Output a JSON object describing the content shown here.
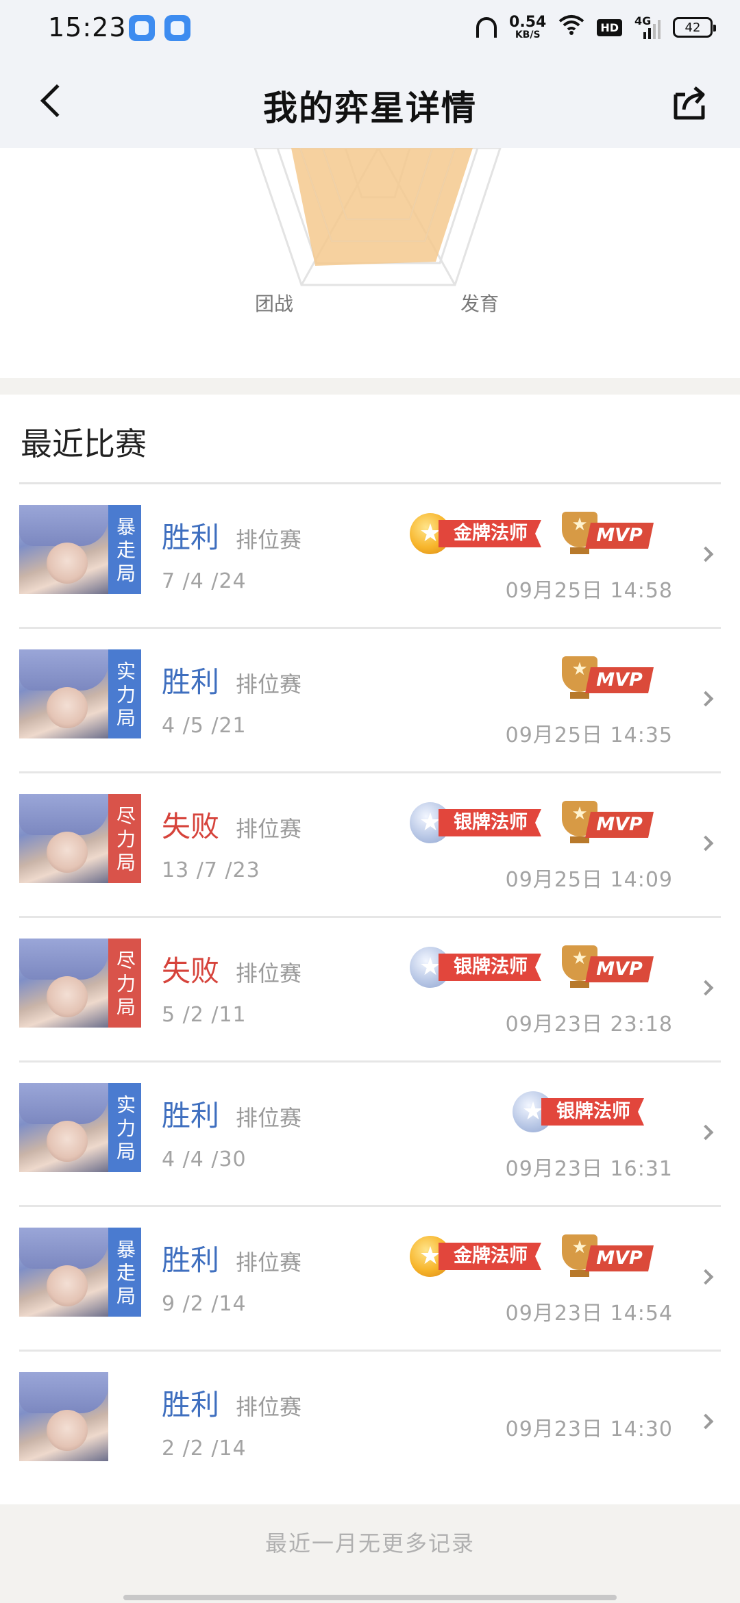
{
  "status_bar": {
    "time": "15:23",
    "net_speed_value": "0.54",
    "net_speed_unit": "KB/S",
    "hd": "HD",
    "network": "4G",
    "battery": "42"
  },
  "header": {
    "title": "我的弈星详情"
  },
  "radar": {
    "label_left": "团战",
    "label_right": "发育",
    "fill_color": "#f4c98e"
  },
  "section": {
    "title": "最近比赛"
  },
  "matches": [
    {
      "mode": "暴走局",
      "mode_color": "blue",
      "result": "胜利",
      "result_type": "win",
      "match_type": "排位赛",
      "kda": "7 /4 /24",
      "time": "09月25日  14:58",
      "medal": "金牌法师",
      "medal_tier": "gold",
      "mvp": "MVP"
    },
    {
      "mode": "实力局",
      "mode_color": "blue",
      "result": "胜利",
      "result_type": "win",
      "match_type": "排位赛",
      "kda": "4 /5 /21",
      "time": "09月25日  14:35",
      "medal": "",
      "medal_tier": "",
      "mvp": "MVP"
    },
    {
      "mode": "尽力局",
      "mode_color": "red",
      "result": "失败",
      "result_type": "lose",
      "match_type": "排位赛",
      "kda": "13 /7 /23",
      "time": "09月25日  14:09",
      "medal": "银牌法师",
      "medal_tier": "silver",
      "mvp": "MVP"
    },
    {
      "mode": "尽力局",
      "mode_color": "red",
      "result": "失败",
      "result_type": "lose",
      "match_type": "排位赛",
      "kda": "5 /2 /11",
      "time": "09月23日  23:18",
      "medal": "银牌法师",
      "medal_tier": "silver",
      "mvp": "MVP"
    },
    {
      "mode": "实力局",
      "mode_color": "blue",
      "result": "胜利",
      "result_type": "win",
      "match_type": "排位赛",
      "kda": "4 /4 /30",
      "time": "09月23日  16:31",
      "medal": "银牌法师",
      "medal_tier": "silver",
      "mvp": ""
    },
    {
      "mode": "暴走局",
      "mode_color": "blue",
      "result": "胜利",
      "result_type": "win",
      "match_type": "排位赛",
      "kda": "9 /2 /14",
      "time": "09月23日  14:54",
      "medal": "金牌法师",
      "medal_tier": "gold",
      "mvp": "MVP"
    },
    {
      "mode": "",
      "mode_color": "",
      "result": "胜利",
      "result_type": "win",
      "match_type": "排位赛",
      "kda": "2 /2 /14",
      "time": "09月23日  14:30",
      "medal": "",
      "medal_tier": "",
      "mvp": ""
    }
  ],
  "footer": {
    "text": "最近一月无更多记录"
  }
}
